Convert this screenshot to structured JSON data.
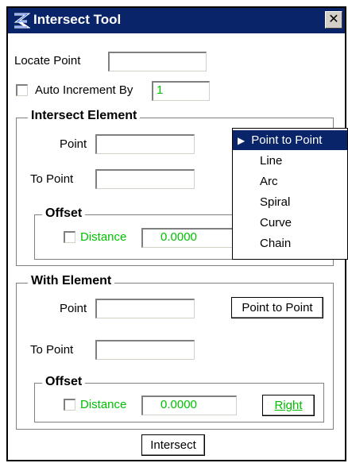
{
  "window": {
    "title": "Intersect Tool",
    "close_glyph": "✕"
  },
  "locate_point": {
    "label": "Locate Point",
    "value": ""
  },
  "auto_increment": {
    "label": "Auto Increment By",
    "value": "1",
    "checked": false
  },
  "intersect_element": {
    "title": "Intersect Element",
    "point": {
      "label": "Point",
      "value": ""
    },
    "to_point": {
      "label": "To Point",
      "value": ""
    },
    "offset": {
      "title": "Offset",
      "distance_label": "Distance",
      "distance_value": "0.0000",
      "checked": false
    }
  },
  "dropdown_menu": {
    "items": [
      "Point to Point",
      "Line",
      "Arc",
      "Spiral",
      "Curve",
      "Chain"
    ],
    "selected": "Point to Point"
  },
  "with_element": {
    "title": "With Element",
    "point": {
      "label": "Point",
      "value": ""
    },
    "method_button": "Point to Point",
    "to_point": {
      "label": "To Point",
      "value": ""
    },
    "offset": {
      "title": "Offset",
      "distance_label": "Distance",
      "distance_value": "0.0000",
      "side_button": "Right",
      "checked": false
    }
  },
  "intersect_button": "Intersect",
  "colors": {
    "titlebar": "#0a246a",
    "green_text": "#00c000",
    "selection": "#0a246a"
  }
}
